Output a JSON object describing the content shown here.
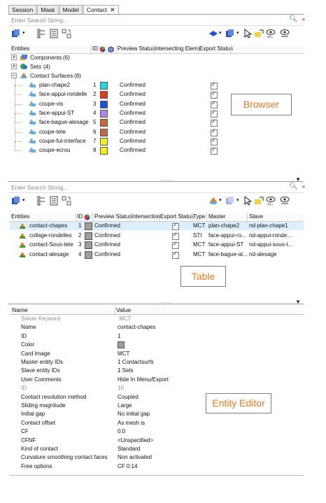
{
  "tabs": [
    {
      "label": "Session"
    },
    {
      "label": "Mask"
    },
    {
      "label": "Model"
    },
    {
      "label": "Contact",
      "active": true
    }
  ],
  "browser": {
    "search_placeholder": "Enter Search String...",
    "headers": [
      "Entities",
      "ID",
      "Preview Status",
      "Intersecting Elems",
      "Export Status"
    ],
    "groups": [
      {
        "label": "Components",
        "count": "(6)"
      },
      {
        "label": "Sets",
        "count": "(4)"
      },
      {
        "label": "Contact Surfaces",
        "count": "(8)"
      }
    ],
    "surfaces": [
      {
        "name": "plan-chape2",
        "id": "1",
        "color": "#20d8e0",
        "status": "Confirmed"
      },
      {
        "name": "face-appui-rondelle",
        "id": "2",
        "color": "#e23a1c",
        "status": "Confirmed"
      },
      {
        "name": "coupe-vis",
        "id": "3",
        "color": "#1e4fd8",
        "status": "Confirmed"
      },
      {
        "name": "face-appui-ST",
        "id": "4",
        "color": "#a98ae6",
        "status": "Confirmed"
      },
      {
        "name": "face-bague-alesage",
        "id": "5",
        "color": "#c9683a",
        "status": "Confirmed"
      },
      {
        "name": "coupe-tete",
        "id": "6",
        "color": "#c26a48",
        "status": "Confirmed"
      },
      {
        "name": "coupe-fut-interface",
        "id": "7",
        "color": "#f3ee2a",
        "status": "Confirmed"
      },
      {
        "name": "coupe-ecrou",
        "id": "8",
        "color": "#f5ef1a",
        "status": "Confirmed"
      }
    ],
    "callout": "Browser"
  },
  "table": {
    "search_placeholder": "Enter Search String...",
    "headers": [
      "Entities",
      "ID",
      "Preview Status",
      "Intersection",
      "Export Status",
      "Type",
      "Master",
      "Slave"
    ],
    "rows": [
      {
        "name": "contact-chapes",
        "id": "1",
        "status": "Confirmed",
        "type": "MCT",
        "master": "plan-chape2",
        "slave": "nd-plan-chape1"
      },
      {
        "name": "collage-rondelles",
        "id": "2",
        "status": "Confirmed",
        "type": "STI",
        "master": "face-appui-ro...",
        "slave": "nd-appui-ronde..."
      },
      {
        "name": "contact-Sous-tete",
        "id": "3",
        "status": "Confirmed",
        "type": "MCT",
        "master": "face-appui-ST",
        "slave": "nd-appui-sous-t..."
      },
      {
        "name": "contact-alesage",
        "id": "4",
        "status": "Confirmed",
        "type": "MCT",
        "master": "face-bague-al...",
        "slave": "nd-alesage"
      }
    ],
    "callout": "Table"
  },
  "editor": {
    "headers": [
      "Name",
      "Value"
    ],
    "rows": [
      {
        "name": "Solver Keyword",
        "value": ".MCT",
        "gray": true
      },
      {
        "name": "Name",
        "value": "contact-chapes"
      },
      {
        "name": "ID",
        "value": "1"
      },
      {
        "name": "Color",
        "value": "",
        "swatch": "#9e9e9e"
      },
      {
        "name": "Card Image",
        "value": "MCT"
      },
      {
        "name": "Master entity IDs",
        "value": "1 Contactsurfs"
      },
      {
        "name": "Slave entity IDs",
        "value": "1 Sets"
      },
      {
        "name": "User Comments",
        "value": "Hide In Menu/Export"
      },
      {
        "name": "ID",
        "value": "10",
        "gray": true
      },
      {
        "name": "Contact resolution method",
        "value": "Coupled"
      },
      {
        "name": "Sliding magnitude",
        "value": "Large"
      },
      {
        "name": "Initial gap",
        "value": "No initial gap"
      },
      {
        "name": "Contact offset",
        "value": "As mesh is"
      },
      {
        "name": "CF",
        "value": "0.0"
      },
      {
        "name": "CFNF",
        "value": "<Unspecified>"
      },
      {
        "name": "Kind of contact",
        "value": "Standard"
      },
      {
        "name": "Curvature smoothing contact faces",
        "value": "Non activated"
      },
      {
        "name": "Free options",
        "value": "CF 0.14"
      }
    ],
    "callout": "Entity Editor"
  }
}
